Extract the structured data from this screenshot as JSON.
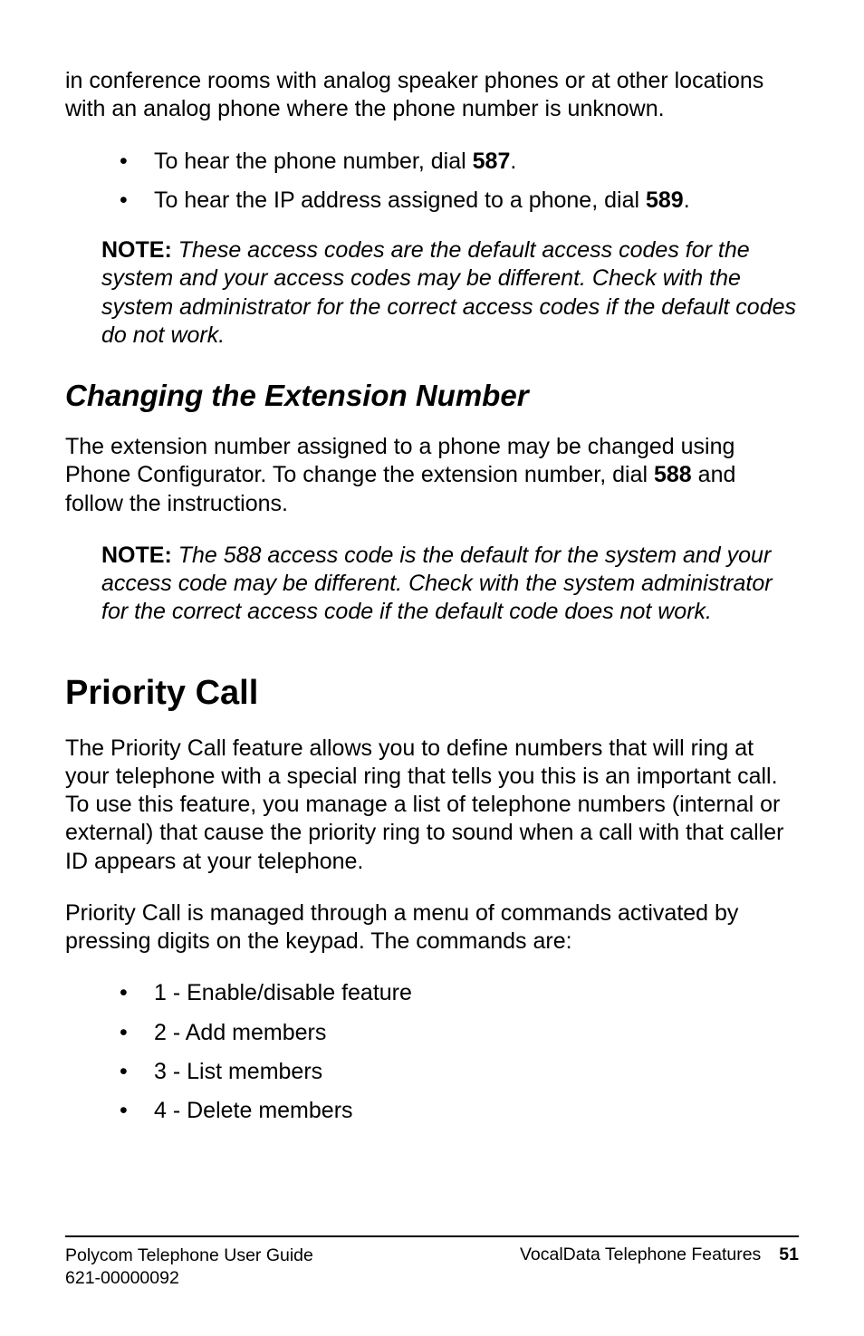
{
  "intro_para": "in conference rooms with analog speaker phones or at other locations with an analog phone where the phone number is unknown.",
  "intro_bullets": [
    {
      "pre": "To hear the phone number, dial ",
      "bold": "587",
      "post": "."
    },
    {
      "pre": "To hear the IP address assigned to a phone, dial ",
      "bold": "589",
      "post": "."
    }
  ],
  "note1": {
    "label": "NOTE:",
    "body": "These access codes are the default access codes for the system and your access codes may be different. Check with the system administrator for the correct access codes if the default codes do not work."
  },
  "section_ext": {
    "heading": "Changing the Extension Number",
    "para_pre": "The extension number assigned to a phone may be changed using Phone Configurator. To change the extension number, dial ",
    "para_bold": "588",
    "para_post": " and follow the instructions.",
    "note": {
      "label": "NOTE:",
      "body": "The 588 access code is the default for the system and your access code may be different. Check with the system administrator for the correct access code if the default code does not work."
    }
  },
  "section_priority": {
    "heading": "Priority Call",
    "para1": "The Priority Call feature allows you to define numbers that will ring at your telephone with a special ring that tells you this is an important call. To use this feature, you manage a list of telephone numbers (internal or external) that cause the priority ring to sound when a call with that caller ID appears at your telephone.",
    "para2": "Priority Call is managed through a menu of commands activated by pressing digits on the keypad. The commands are:",
    "bullets": [
      "1 - Enable/disable feature",
      "2 - Add members",
      "3 - List members",
      "4 - Delete members"
    ]
  },
  "footer": {
    "left_line1": "Polycom Telephone User Guide",
    "left_line2": "621-00000092",
    "right_text": "VocalData Telephone Features",
    "page_number": "51"
  }
}
